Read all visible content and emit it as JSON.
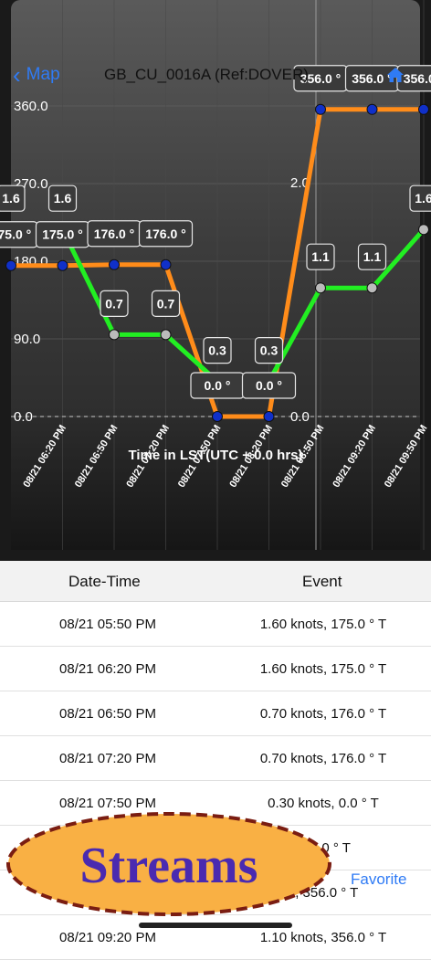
{
  "nav": {
    "back_label": "Map",
    "title": "GB_CU_0016A (Ref:DOVER)"
  },
  "chart_data": {
    "type": "line",
    "xlabel": "Time in LST(UTC + 0.0 hrs)",
    "categories": [
      "08/21 05:50 PM",
      "08/21 06:20 PM",
      "08/21 06:50 PM",
      "08/21 07:20 PM",
      "08/21 07:50 PM",
      "08/21 08:20 PM",
      "08/21 08:50 PM",
      "08/21 09:20 PM",
      "08/21 09:50 PM"
    ],
    "x_tick_labels": [
      "08/21 06:20 PM",
      "08/21 06:50 PM",
      "08/21 07:20 PM",
      "08/21 07:50 PM",
      "08/21 08:20 PM",
      "08/21 08:50 PM",
      "08/21 09:20 PM",
      "08/21 09:50 PM"
    ],
    "left_axis_ticks": [
      "360.0",
      "270.0",
      "180.0",
      "90.0",
      "0.0"
    ],
    "right_axis_ticks": [
      "2.0",
      "0.0"
    ],
    "series": [
      {
        "axis": "left",
        "color": "#ff8c1a",
        "point_color": "#1030c8",
        "values": [
          175.0,
          175.0,
          176.0,
          176.0,
          0.0,
          0.0,
          356.0,
          356.0,
          356.0
        ],
        "labels": [
          "175.0 °",
          "175.0 °",
          "176.0 °",
          "176.0 °",
          "0.0 °",
          "0.0 °",
          "356.0 °",
          "356.0 °",
          "356.0 °"
        ]
      },
      {
        "axis": "right",
        "color": "#22ee22",
        "point_color": "#bbbbbb",
        "values": [
          1.6,
          1.6,
          0.7,
          0.7,
          0.3,
          0.3,
          1.1,
          1.1,
          1.6
        ],
        "labels": [
          "1.6",
          "1.6",
          "0.7",
          "0.7",
          "0.3",
          "0.3",
          "1.1",
          "1.1",
          "1.6"
        ]
      }
    ]
  },
  "table": {
    "headers": [
      "Date-Time",
      "Event"
    ],
    "rows": [
      {
        "dt": "08/21 05:50 PM",
        "ev": "1.60 knots, 175.0 ° T"
      },
      {
        "dt": "08/21 06:20 PM",
        "ev": "1.60 knots, 175.0 ° T"
      },
      {
        "dt": "08/21 06:50 PM",
        "ev": "0.70 knots, 176.0 ° T"
      },
      {
        "dt": "08/21 07:20 PM",
        "ev": "0.70 knots, 176.0 ° T"
      },
      {
        "dt": "08/21 07:50 PM",
        "ev": "0.30 knots, 0.0 ° T"
      },
      {
        "dt": "",
        "ev": "s, 0.0 ° T"
      },
      {
        "dt": "",
        "ev": "s, 356.0 ° T"
      },
      {
        "dt": "08/21 09:20 PM",
        "ev": "1.10 knots, 356.0 ° T"
      }
    ]
  },
  "favorite_label": "Favorite",
  "badge_text": "Streams",
  "colors": {
    "accent": "#2f7bf5",
    "badge_fill": "#f9b044",
    "badge_text": "#4a2ab0",
    "badge_border": "#7a1d12"
  }
}
